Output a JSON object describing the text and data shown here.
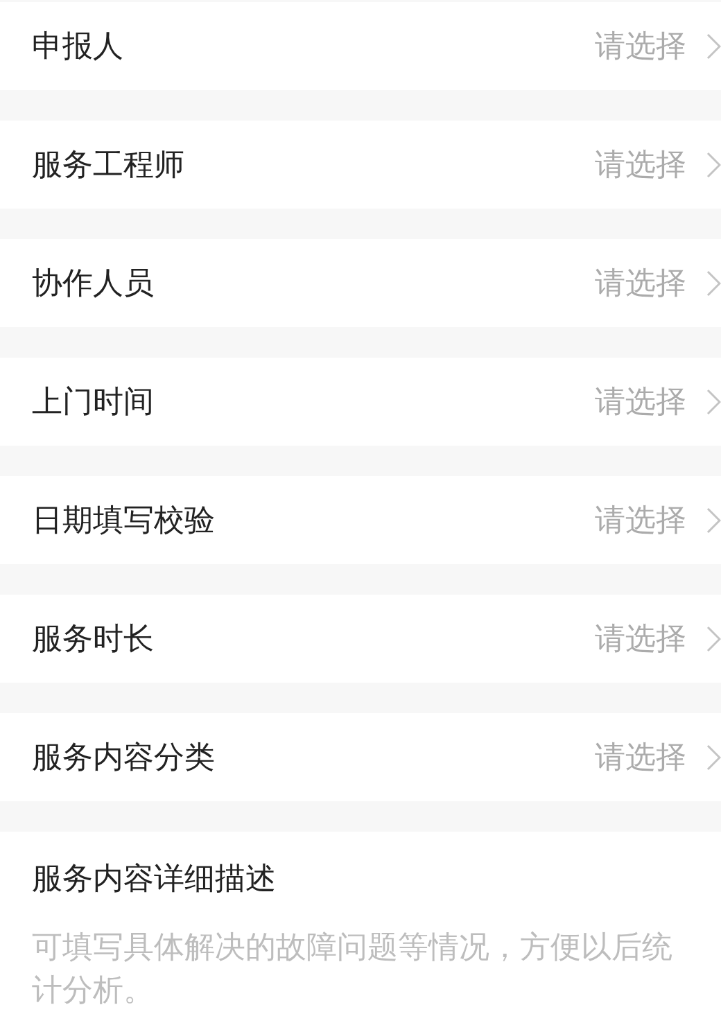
{
  "fields": [
    {
      "label": "申报人",
      "placeholder": "请选择"
    },
    {
      "label": "服务工程师",
      "placeholder": "请选择"
    },
    {
      "label": "协作人员",
      "placeholder": "请选择"
    },
    {
      "label": "上门时间",
      "placeholder": "请选择"
    },
    {
      "label": "日期填写校验",
      "placeholder": "请选择"
    },
    {
      "label": "服务时长",
      "placeholder": "请选择"
    },
    {
      "label": "服务内容分类",
      "placeholder": "请选择"
    }
  ],
  "description": {
    "label": "服务内容详细描述",
    "placeholder": "可填写具体解决的故障问题等情况，方便以后统计分析。"
  }
}
